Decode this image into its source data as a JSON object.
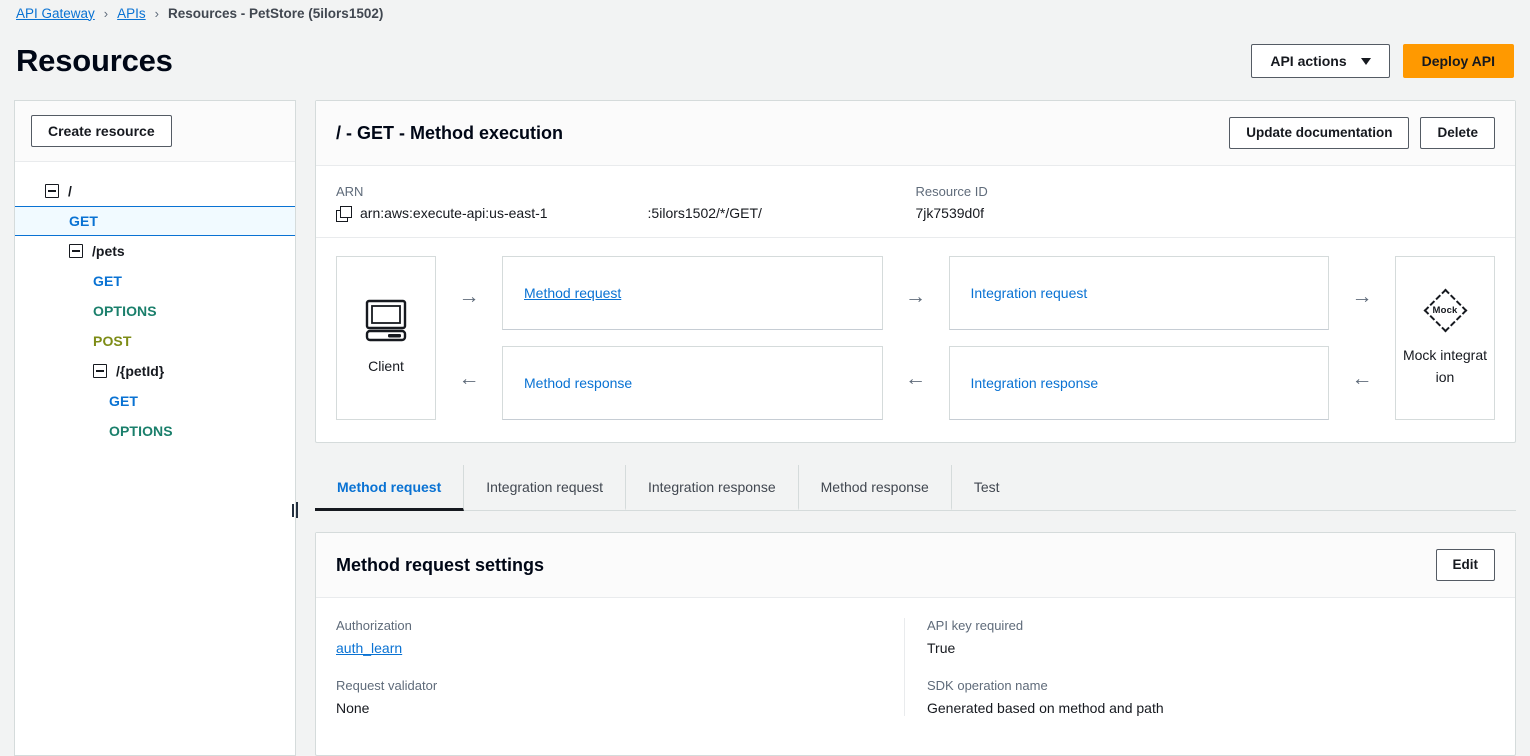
{
  "breadcrumb": {
    "items": [
      {
        "label": "API Gateway",
        "type": "link"
      },
      {
        "label": "APIs",
        "type": "link"
      },
      {
        "label": "Resources - PetStore (5ilors1502)",
        "type": "current"
      }
    ],
    "separator": "›"
  },
  "header": {
    "title": "Resources",
    "api_actions_label": "API actions",
    "deploy_label": "Deploy API",
    "accent_orange": "#ff9900"
  },
  "sidebar": {
    "create_resource_label": "Create resource",
    "tree": [
      {
        "label": "/",
        "kind": "path",
        "indent": 0,
        "expandable": true,
        "selected": false
      },
      {
        "label": "GET",
        "kind": "get",
        "indent": 1,
        "expandable": false,
        "selected": true
      },
      {
        "label": "/pets",
        "kind": "path",
        "indent": 1,
        "expandable": true,
        "selected": false
      },
      {
        "label": "GET",
        "kind": "get",
        "indent": 2,
        "expandable": false,
        "selected": false
      },
      {
        "label": "OPTIONS",
        "kind": "options",
        "indent": 2,
        "expandable": false,
        "selected": false
      },
      {
        "label": "POST",
        "kind": "post",
        "indent": 2,
        "expandable": false,
        "selected": false
      },
      {
        "label": "/{petId}",
        "kind": "path",
        "indent": 2,
        "expandable": true,
        "selected": false
      },
      {
        "label": "GET",
        "kind": "get",
        "indent": 3,
        "expandable": false,
        "selected": false
      },
      {
        "label": "OPTIONS",
        "kind": "options",
        "indent": 3,
        "expandable": false,
        "selected": false
      }
    ],
    "method_colors": {
      "get": "#0972d3",
      "options": "#1a7f6b",
      "post": "#7d8c16"
    }
  },
  "method_execution": {
    "title": "/ - GET - Method execution",
    "update_documentation_label": "Update documentation",
    "delete_label": "Delete",
    "arn_label": "ARN",
    "arn_prefix": "arn:aws:execute-api:us-east-1",
    "arn_suffix": ":5ilors1502/*/GET/",
    "resource_id_label": "Resource ID",
    "resource_id_value": "7jk7539d0f"
  },
  "flow": {
    "client_label": "Client",
    "method_request_label": "Method request",
    "method_response_label": "Method response",
    "integration_request_label": "Integration request",
    "integration_response_label": "Integration response",
    "integration_type_label": "Mock integration",
    "integration_badge_text": "Mock",
    "arrow_right": "→",
    "arrow_left": "←"
  },
  "tabs": [
    {
      "label": "Method request",
      "active": true
    },
    {
      "label": "Integration request",
      "active": false
    },
    {
      "label": "Integration response",
      "active": false
    },
    {
      "label": "Method response",
      "active": false
    },
    {
      "label": "Test",
      "active": false
    }
  ],
  "settings": {
    "title": "Method request settings",
    "edit_label": "Edit",
    "left": [
      {
        "label": "Authorization",
        "value": "auth_learn",
        "is_link": true
      },
      {
        "label": "Request validator",
        "value": "None",
        "is_link": false
      }
    ],
    "right": [
      {
        "label": "API key required",
        "value": "True",
        "is_link": false
      },
      {
        "label": "SDK operation name",
        "value": "Generated based on method and path",
        "is_link": false
      }
    ]
  }
}
